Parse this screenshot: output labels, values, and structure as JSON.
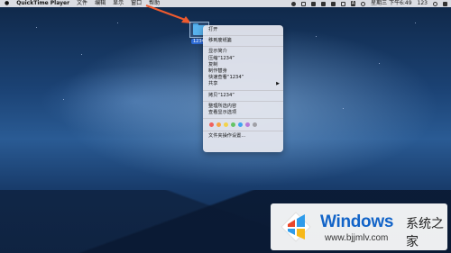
{
  "menubar": {
    "app_name": "QuickTime Player",
    "items": [
      "文件",
      "编辑",
      "显示",
      "窗口",
      "帮助"
    ],
    "input_badge": "A",
    "clock": "星期三 下午6:49",
    "user": "123"
  },
  "desktop": {
    "folder_label": "1234"
  },
  "context_menu": {
    "group1": [
      "打开"
    ],
    "group2": [
      "移到废纸篓"
    ],
    "group3": [
      "显示简介",
      "压缩“1234”",
      "复制",
      "制作替身",
      "快速查看“1234”",
      "共享"
    ],
    "group4": [
      "拷贝“1234”"
    ],
    "group5": [
      "整理所选内容",
      "查看显示选项"
    ],
    "tags": [
      "#f0605d",
      "#f5a344",
      "#f2d34b",
      "#64c466",
      "#3fa2f1",
      "#b77ad9",
      "#a0a0a6"
    ],
    "group6": [
      "文件夹操作设置..."
    ]
  },
  "watermark": {
    "brand": "Windows",
    "subtitle": "系统之家",
    "url": "www.bjjmlv.com"
  },
  "colors": {
    "accent": "#1264c8",
    "arrow": "#ee5a2e"
  }
}
